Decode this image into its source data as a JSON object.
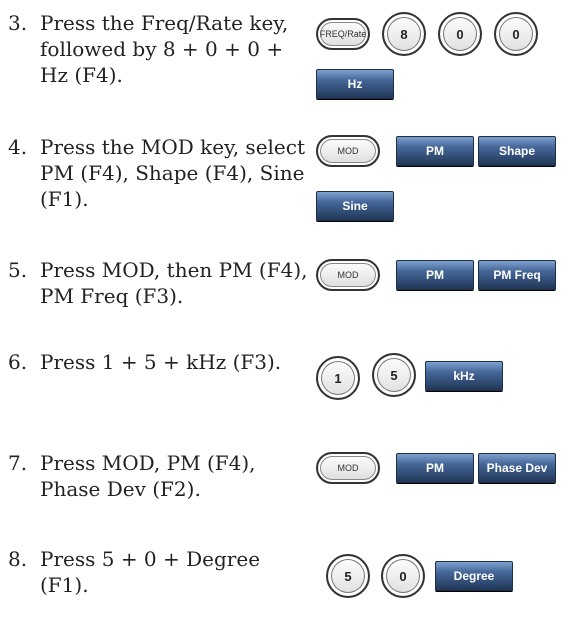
{
  "steps": [
    {
      "number": "3.",
      "text": "Press the Freq/Rate key, followed by 8 + 0 + 0 + Hz (F4).",
      "keys": {
        "freq_rate": "FREQ/Rate",
        "d1": "8",
        "d2": "0",
        "d3": "0",
        "hz": "Hz"
      }
    },
    {
      "number": "4.",
      "text": "Press the MOD key, select PM (F4), Shape (F4), Sine (F1).",
      "keys": {
        "mod": "MOD",
        "pm": "PM",
        "shape": "Shape",
        "sine": "Sine"
      }
    },
    {
      "number": "5.",
      "text": "Press MOD, then PM (F4), PM Freq (F3).",
      "keys": {
        "mod": "MOD",
        "pm": "PM",
        "pm_freq": "PM Freq"
      }
    },
    {
      "number": "6.",
      "text": "Press 1 + 5 + kHz (F3).",
      "keys": {
        "d1": "1",
        "d2": "5",
        "khz": "kHz"
      }
    },
    {
      "number": "7.",
      "text": "Press MOD, PM (F4), Phase Dev (F2).",
      "keys": {
        "mod": "MOD",
        "pm": "PM",
        "phase_dev": "Phase Dev"
      }
    },
    {
      "number": "8.",
      "text": "Press 5 + 0 + Degree (F1).",
      "keys": {
        "d1": "5",
        "d2": "0",
        "degree": "Degree"
      }
    }
  ]
}
